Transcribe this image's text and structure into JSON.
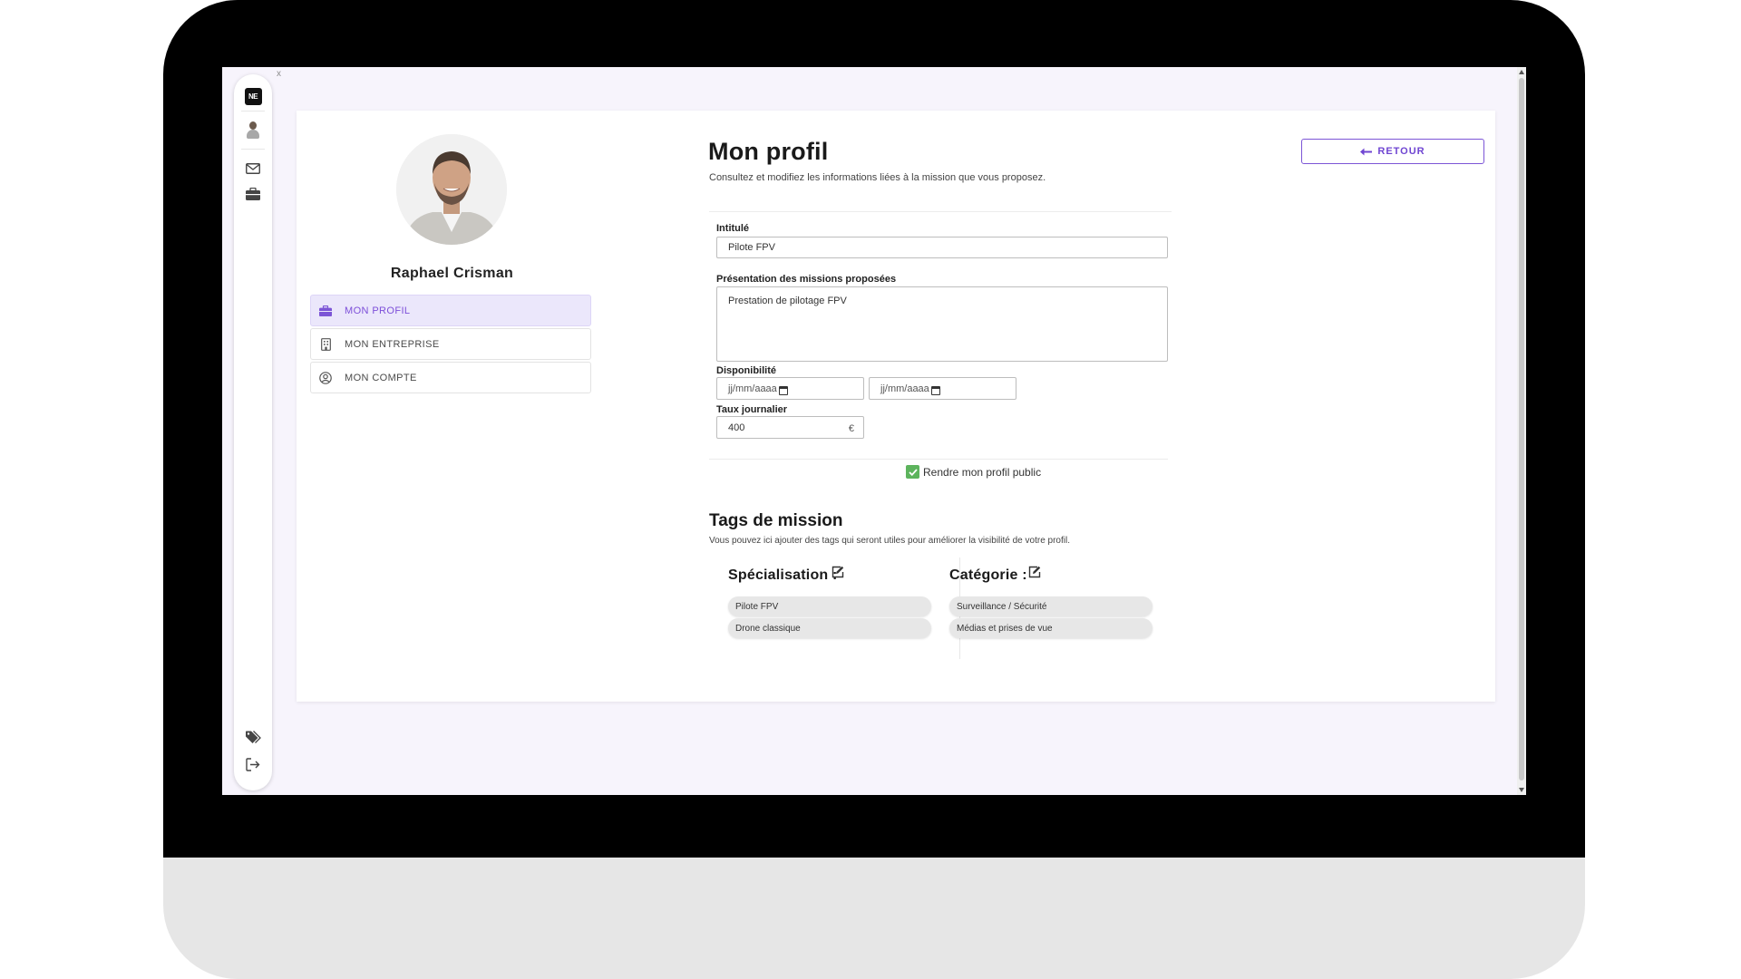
{
  "sidebar_icons": {
    "logo_text": "NE",
    "avatar": "avatar-icon",
    "mail": "envelope-icon",
    "briefcase": "briefcase-icon",
    "tags": "tags-icon",
    "logout": "logout-icon"
  },
  "profile": {
    "name": "Raphael Crisman"
  },
  "nav": {
    "items": [
      {
        "label": "MON PROFIL",
        "icon": "briefcase-icon",
        "active": true
      },
      {
        "label": "MON ENTREPRISE",
        "icon": "building-icon",
        "active": false
      },
      {
        "label": "MON COMPTE",
        "icon": "user-circle-icon",
        "active": false
      }
    ]
  },
  "header": {
    "title": "Mon profil",
    "subtitle": "Consultez et modifiez les informations liées à la mission que vous proposez.",
    "back_label": "RETOUR"
  },
  "form": {
    "intitule_label": "Intitulé",
    "intitule_value": "Pilote FPV",
    "presentation_label": "Présentation des missions proposées",
    "presentation_value": "Prestation de pilotage FPV",
    "disponibilite_label": "Disponibilité",
    "date_start_placeholder": "jj/mm/aaaa",
    "date_end_placeholder": "jj/mm/aaaa",
    "taux_label": "Taux journalier",
    "taux_value": "400",
    "currency": "€",
    "public_label": "Rendre mon profil public",
    "public_checked": true
  },
  "tags": {
    "title": "Tags de mission",
    "subtitle": "Vous pouvez ici ajouter des tags qui seront utiles pour améliorer la visibilité de votre profil.",
    "specialisation_label": "Spécialisation :",
    "specialisation": [
      "Pilote FPV",
      "Drone classique"
    ],
    "categorie_label": "Catégorie :",
    "categorie": [
      "Surveillance / Sécurité",
      "Médias et prises de vue"
    ]
  },
  "colors": {
    "accent": "#7c55d6",
    "active_bg": "#ebe7fb",
    "check_green": "#5db45d",
    "screen_bg": "#f7f4fc"
  }
}
